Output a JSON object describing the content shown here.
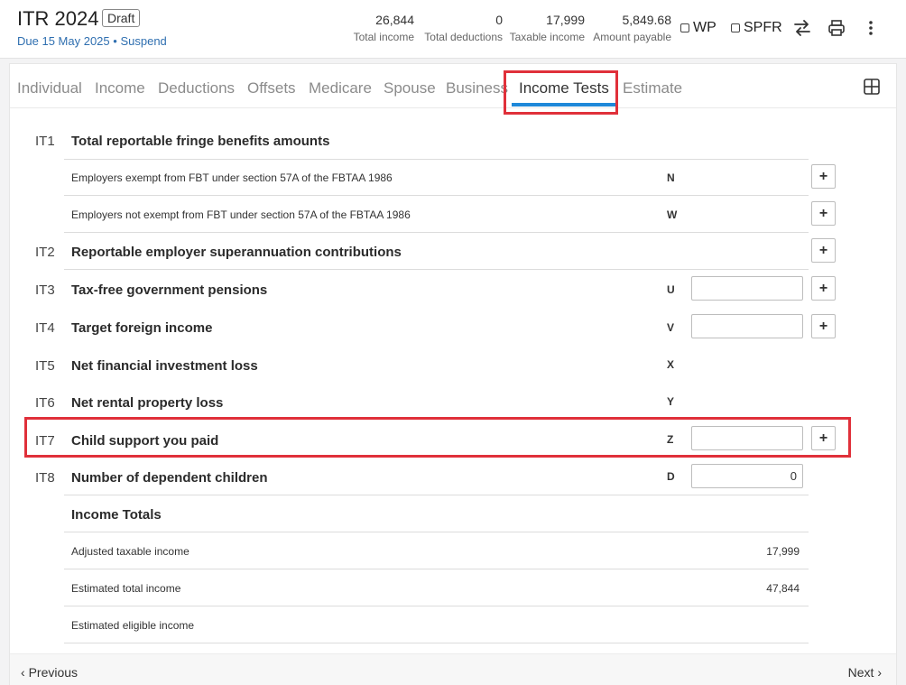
{
  "header": {
    "title": "ITR 2024",
    "badge": "Draft",
    "due_prefix": "Due",
    "due_date": "15 May 2025",
    "separator": "•",
    "suspend": "Suspend",
    "stats": [
      {
        "value": "26,844",
        "label": "Total income"
      },
      {
        "value": "0",
        "label": "Total deductions"
      },
      {
        "value": "17,999",
        "label": "Taxable income"
      },
      {
        "value": "5,849.68",
        "label": "Amount payable"
      }
    ],
    "checkboxes": [
      {
        "label": "WP",
        "checked": false
      },
      {
        "label": "SPFR",
        "checked": false
      }
    ],
    "icons": [
      "swap-icon",
      "print-icon",
      "more-vertical-icon"
    ]
  },
  "tabs": [
    {
      "label": "Individual",
      "active": false
    },
    {
      "label": "Income",
      "active": false
    },
    {
      "label": "Deductions",
      "active": false
    },
    {
      "label": "Offsets",
      "active": false
    },
    {
      "label": "Medicare",
      "active": false
    },
    {
      "label": "Spouse",
      "active": false
    },
    {
      "label": "Business",
      "active": false
    },
    {
      "label": "Income Tests",
      "active": true
    },
    {
      "label": "Estimate",
      "active": false
    }
  ],
  "accent_color": "#1e88d9",
  "highlight_color": "#e0303a",
  "rows": {
    "it1": {
      "code": "IT1",
      "title": "Total reportable fringe benefits amounts"
    },
    "it1_n": {
      "label": "Employers exempt from FBT under section 57A of the FBTAA 1986",
      "letter": "N",
      "action": "+"
    },
    "it1_w": {
      "label": "Employers not exempt from FBT under section 57A of the FBTAA 1986",
      "letter": "W",
      "action": "+"
    },
    "it2": {
      "code": "IT2",
      "title": "Reportable employer superannuation contributions",
      "action": "+"
    },
    "it3": {
      "code": "IT3",
      "title": "Tax-free government pensions",
      "letter": "U",
      "value": "",
      "action": "+"
    },
    "it4": {
      "code": "IT4",
      "title": "Target foreign income",
      "letter": "V",
      "value": "",
      "action": "+"
    },
    "it5": {
      "code": "IT5",
      "title": "Net financial investment loss",
      "letter": "X"
    },
    "it6": {
      "code": "IT6",
      "title": "Net rental property loss",
      "letter": "Y"
    },
    "it7": {
      "code": "IT7",
      "title": "Child support you paid",
      "letter": "Z",
      "value": "",
      "action": "+"
    },
    "it8": {
      "code": "IT8",
      "title": "Number of dependent children",
      "letter": "D",
      "value": "0"
    }
  },
  "totals": {
    "title": "Income Totals",
    "adjusted_taxable": {
      "label": "Adjusted taxable income",
      "value": "17,999"
    },
    "estimated_total": {
      "label": "Estimated total income",
      "value": "47,844"
    },
    "estimated_eligible": {
      "label": "Estimated eligible income",
      "value": ""
    }
  },
  "footer": {
    "previous": "Previous",
    "next": "Next"
  }
}
